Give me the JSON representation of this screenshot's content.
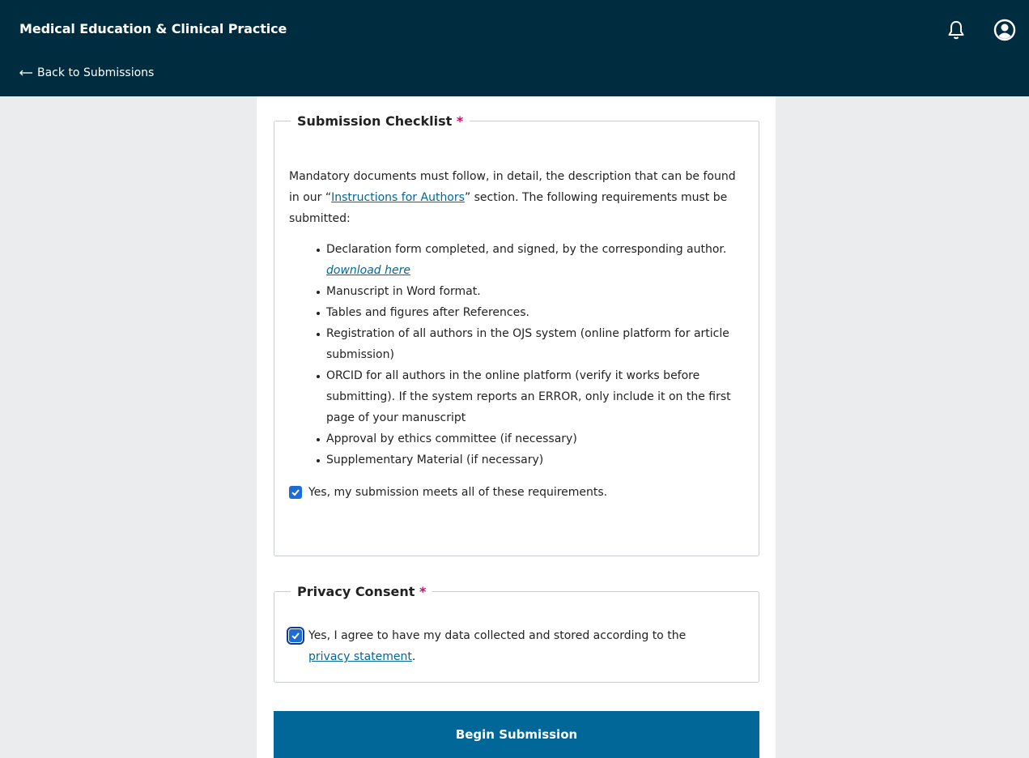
{
  "header": {
    "title": "Medical Education & Clinical Practice",
    "back_label": "Back to Submissions",
    "icons": [
      "bell-icon",
      "user-icon"
    ],
    "background": "#002c40"
  },
  "checklist": {
    "legend": "Submission Checklist",
    "required_mark": "*",
    "intro_before": "Mandatory documents must follow, in detail, the description that can be found in our “",
    "intro_link": "Instructions for Authors",
    "intro_after": "” section. The following requirements must be submitted:",
    "item1_text": "Declaration form completed, and signed, by the corresponding author. ",
    "item1_link": "download here",
    "items": [
      "Manuscript in Word format.",
      "Tables and figures after References.",
      "Registration of all authors in the OJS system (online platform for article submission)",
      "ORCID for all authors in the online platform (verify it works before submitting). If the system reports an ERROR, only include it on the first page of your manuscript",
      "Approval by ethics committee (if necessary)",
      "Supplementary Material (if necessary)"
    ],
    "confirm_label": "Yes, my submission meets all of these requirements.",
    "confirm_checked": true
  },
  "privacy": {
    "legend": "Privacy Consent",
    "required_mark": "*",
    "consent_text": "Yes, I agree to have my data collected and stored according to the ",
    "consent_link": "privacy statement",
    "consent_end": ".",
    "consent_checked": true
  },
  "actions": {
    "begin_label": "Begin Submission"
  },
  "colors": {
    "accent": "#006798",
    "required": "#d00a6c",
    "checkbox": "#1e6bd6"
  }
}
